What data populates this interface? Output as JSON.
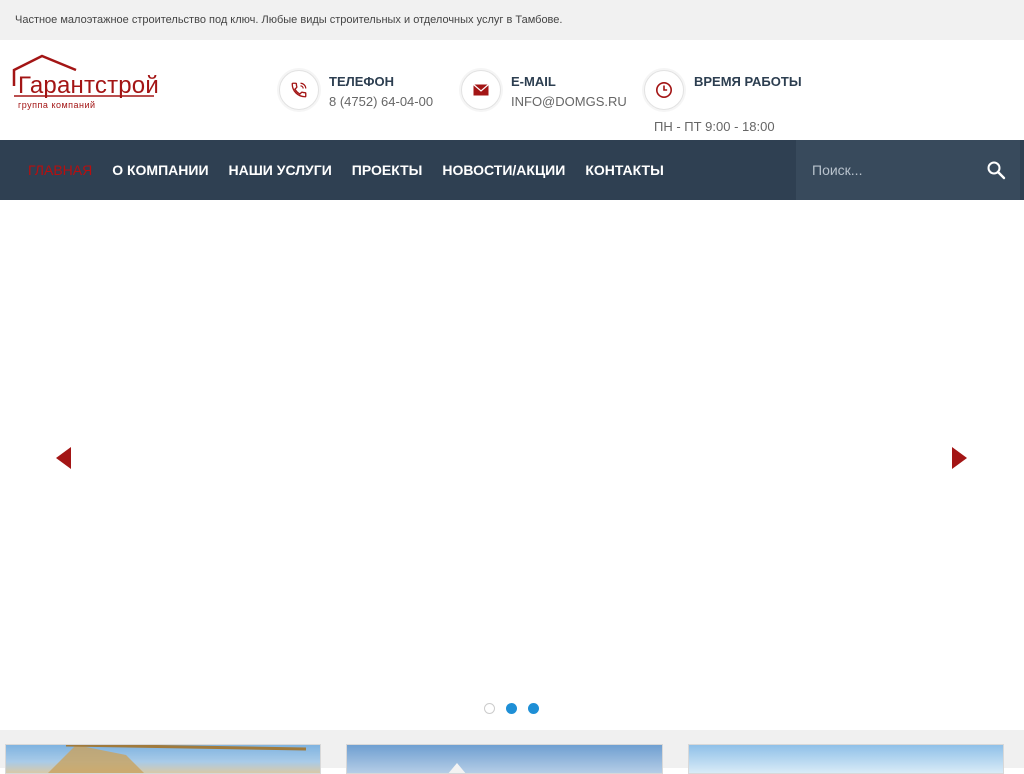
{
  "topbar": {
    "tagline": "Частное малоэтажное строительство под ключ. Любые виды строительных и отделочных услуг в Тамбове."
  },
  "logo": {
    "name": "Гарантстрой",
    "subtitle": "группа компаний"
  },
  "contacts": {
    "phone": {
      "title": "ТЕЛЕФОН",
      "value": "8 (4752) 64-04-00",
      "icon": "phone-icon"
    },
    "email": {
      "title": "E-MAIL",
      "value": "INFO@DOMGS.RU",
      "icon": "mail-icon"
    },
    "hours": {
      "title": "ВРЕМЯ РАБОТЫ",
      "value": "ПН - ПТ 9:00 - 18:00",
      "icon": "clock-icon"
    }
  },
  "nav": {
    "items": [
      {
        "label": "ГЛАВНАЯ",
        "active": true
      },
      {
        "label": "О КОМПАНИИ"
      },
      {
        "label": "НАШИ УСЛУГИ"
      },
      {
        "label": "ПРОЕКТЫ"
      },
      {
        "label": "НОВОСТИ/АКЦИИ"
      },
      {
        "label": "КОНТАКТЫ"
      }
    ],
    "search": {
      "placeholder": "Поиск..."
    }
  },
  "slider": {
    "slides": 3,
    "active_index": 0
  },
  "colors": {
    "accent": "#b80f0f",
    "nav_bg": "#2f4052",
    "dot_active": "#1e8fd6"
  }
}
